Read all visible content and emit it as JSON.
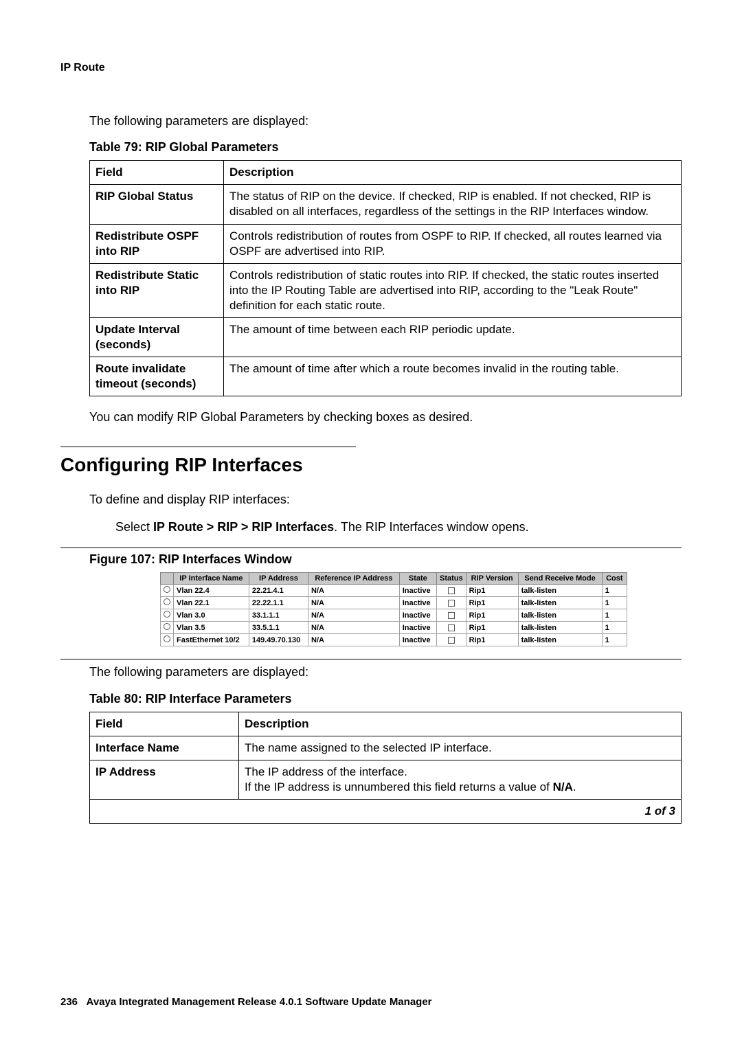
{
  "running_head": "IP Route",
  "intro_text_1": "The following parameters are displayed:",
  "table79": {
    "caption": "Table 79: RIP Global Parameters",
    "head_field": "Field",
    "head_desc": "Description",
    "rows": [
      {
        "field": "RIP Global Status",
        "desc": "The status of RIP on the device. If checked, RIP is enabled. If not checked, RIP is disabled on all interfaces, regardless of the settings in the RIP Interfaces window."
      },
      {
        "field": "Redistribute OSPF into RIP",
        "desc": "Controls redistribution of routes from OSPF to RIP. If checked, all routes learned via OSPF are advertised into RIP."
      },
      {
        "field": "Redistribute Static into RIP",
        "desc": "Controls redistribution of static routes into RIP. If checked, the static routes inserted into the IP Routing Table are advertised into RIP, according to the \"Leak Route\" definition for each static route."
      },
      {
        "field": "Update Interval (seconds)",
        "desc": "The amount of time between each RIP periodic update."
      },
      {
        "field": "Route invalidate timeout (seconds)",
        "desc": "The amount of time after which a route becomes invalid in the routing table."
      }
    ]
  },
  "modify_text": "You can modify RIP Global Parameters by checking boxes as desired.",
  "section_heading": "Configuring RIP Interfaces",
  "define_text": "To define and display RIP interfaces:",
  "step_prefix": "Select ",
  "step_bold": "IP Route > RIP > RIP Interfaces",
  "step_suffix": ". The RIP Interfaces window opens.",
  "figure_caption": "Figure 107: RIP Interfaces Window",
  "shot": {
    "head": {
      "sel": "",
      "name": "IP Interface Name",
      "ip": "IP Address",
      "ref": "Reference IP Address",
      "state": "State",
      "status": "Status",
      "ver": "RIP Version",
      "mode": "Send Receive Mode",
      "cost": "Cost"
    },
    "rows": [
      {
        "name": "Vlan 22.4",
        "ip": "22.21.4.1",
        "ref": "N/A",
        "state": "Inactive",
        "ver": "Rip1",
        "mode": "talk-listen",
        "cost": "1"
      },
      {
        "name": "Vlan 22.1",
        "ip": "22.22.1.1",
        "ref": "N/A",
        "state": "Inactive",
        "ver": "Rip1",
        "mode": "talk-listen",
        "cost": "1"
      },
      {
        "name": "Vlan 3.0",
        "ip": "33.1.1.1",
        "ref": "N/A",
        "state": "Inactive",
        "ver": "Rip1",
        "mode": "talk-listen",
        "cost": "1"
      },
      {
        "name": "Vlan 3.5",
        "ip": "33.5.1.1",
        "ref": "N/A",
        "state": "Inactive",
        "ver": "Rip1",
        "mode": "talk-listen",
        "cost": "1"
      },
      {
        "name": "FastEthernet 10/2",
        "ip": "149.49.70.130",
        "ref": "N/A",
        "state": "Inactive",
        "ver": "Rip1",
        "mode": "talk-listen",
        "cost": "1"
      }
    ]
  },
  "intro_text_2": "The following parameters are displayed:",
  "table80": {
    "caption": "Table 80: RIP Interface Parameters",
    "head_field": "Field",
    "head_desc": "Description",
    "rows": [
      {
        "field": "Interface Name",
        "desc": "The name assigned to the selected IP interface."
      },
      {
        "field": "IP Address",
        "desc_pre": "The IP address of the interface.\nIf the IP address is unnumbered this field returns a value of ",
        "desc_bold": "N/A",
        "desc_post": "."
      }
    ],
    "footer": "1 of 3"
  },
  "footer": {
    "page_no": "236",
    "title": "Avaya Integrated Management Release 4.0.1 Software Update Manager"
  }
}
